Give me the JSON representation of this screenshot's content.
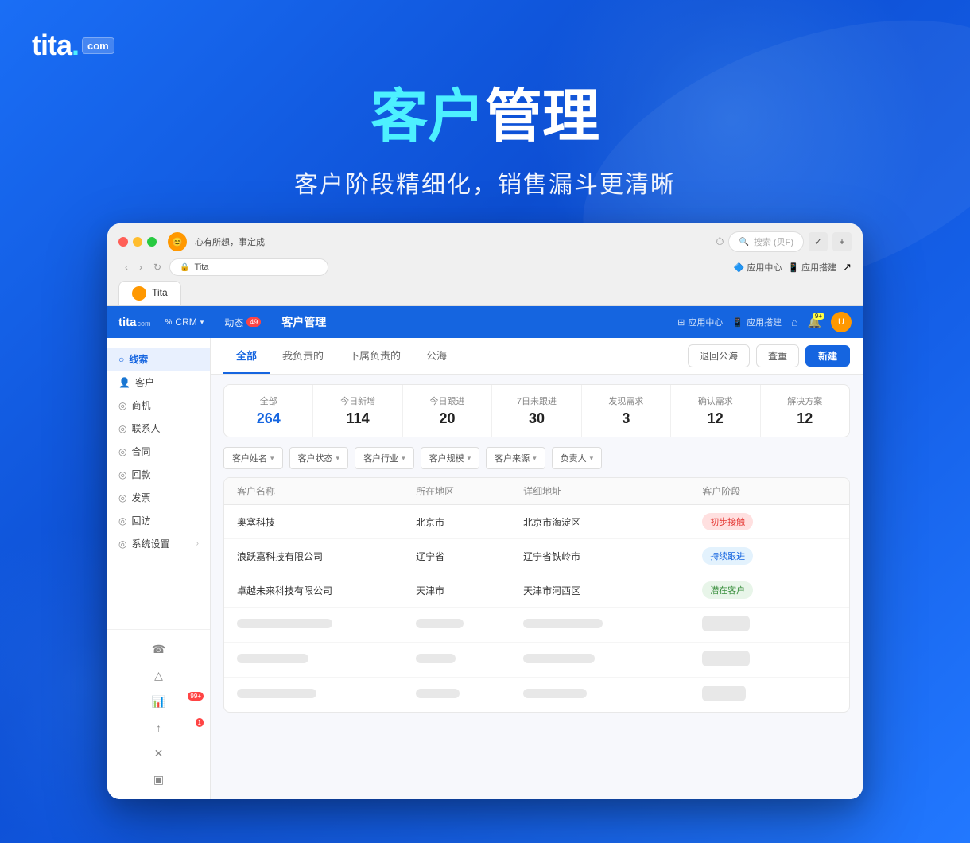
{
  "branding": {
    "logo_text": "tita",
    "logo_com": "com",
    "tagline_highlight": "客户",
    "tagline_normal": "管理",
    "subtitle": "客户阶段精细化，销售漏斗更清晰"
  },
  "browser": {
    "tab_label": "Tita",
    "url": "Tita",
    "toolbar_actions": [
      "✓",
      "+"
    ],
    "top_right": [
      "应用中心",
      "应用搭建"
    ]
  },
  "app_nav": {
    "logo": "tita",
    "logo_com": "com",
    "menu_crm": "CRM",
    "menu_activity": "动态",
    "badge_activity": "49",
    "page_title": "客户管理",
    "top_right": {
      "app_center": "应用中心",
      "app_build": "应用搭建"
    }
  },
  "sidebar": {
    "items": [
      {
        "label": "线索",
        "icon": "👤",
        "active": true
      },
      {
        "label": "客户",
        "icon": "👤"
      },
      {
        "label": "商机",
        "icon": "◎"
      },
      {
        "label": "联系人",
        "icon": "◎"
      },
      {
        "label": "合同",
        "icon": "◎"
      },
      {
        "label": "回款",
        "icon": "◎"
      },
      {
        "label": "发票",
        "icon": "◎"
      },
      {
        "label": "回访",
        "icon": "◎"
      },
      {
        "label": "系统设置",
        "icon": "◎"
      }
    ],
    "bottom_items": [
      {
        "icon": "☎",
        "badge": ""
      },
      {
        "icon": "△"
      },
      {
        "icon": "📊",
        "badge": "99+"
      },
      {
        "icon": "↑",
        "badge": "1"
      },
      {
        "icon": "✕"
      },
      {
        "icon": "▣"
      }
    ]
  },
  "tabs": [
    {
      "label": "全部",
      "active": true
    },
    {
      "label": "我负责的"
    },
    {
      "label": "下属负责的"
    },
    {
      "label": "公海"
    }
  ],
  "tab_actions": {
    "return": "退回公海",
    "duplicate": "查重",
    "create": "新建"
  },
  "stats": [
    {
      "label": "全部",
      "value": "264",
      "highlight": true
    },
    {
      "label": "今日新增",
      "value": "114"
    },
    {
      "label": "今日跟进",
      "value": "20"
    },
    {
      "label": "7日未跟进",
      "value": "30"
    },
    {
      "label": "发现需求",
      "value": "3"
    },
    {
      "label": "确认需求",
      "value": "12"
    },
    {
      "label": "解决方案",
      "value": "12"
    }
  ],
  "filters": [
    {
      "label": "客户姓名"
    },
    {
      "label": "客户状态"
    },
    {
      "label": "客户行业"
    },
    {
      "label": "客户规模"
    },
    {
      "label": "客户来源"
    },
    {
      "label": "负责人"
    }
  ],
  "table_headers": [
    "客户名称",
    "所在地区",
    "详细地址",
    "客户阶段"
  ],
  "table_rows": [
    {
      "name": "奥塞科技",
      "region": "北京市",
      "address": "北京市海淀区",
      "stage": "初步接触",
      "stage_class": "initial"
    },
    {
      "name": "浪跃嘉科技有限公司",
      "region": "辽宁省",
      "address": "辽宁省铁岭市",
      "stage": "持续跟进",
      "stage_class": "followup"
    },
    {
      "name": "卓越未来科技有限公司",
      "region": "天津市",
      "address": "天津市河西区",
      "stage": "潜在客户",
      "stage_class": "potential"
    }
  ],
  "skeleton_rows": [
    {
      "stage_class": "yellow"
    },
    {
      "stage_class": "lightblue"
    },
    {
      "stage_class": "purple"
    }
  ]
}
